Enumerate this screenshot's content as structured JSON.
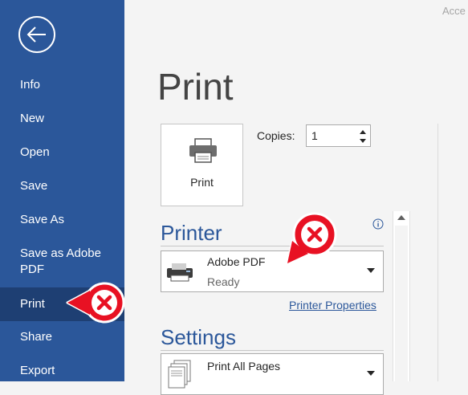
{
  "header": {
    "top_right_text": "Acce"
  },
  "sidebar": {
    "items": [
      {
        "label": "Info"
      },
      {
        "label": "New"
      },
      {
        "label": "Open"
      },
      {
        "label": "Save"
      },
      {
        "label": "Save As"
      },
      {
        "label_line1": "Save as Adobe",
        "label_line2": "PDF"
      },
      {
        "label": "Print",
        "selected": true
      },
      {
        "label": "Share"
      },
      {
        "label": "Export"
      }
    ]
  },
  "main": {
    "title": "Print",
    "print_button_label": "Print",
    "copies": {
      "label": "Copies:",
      "value": "1"
    },
    "printer_section": {
      "title": "Printer",
      "selected_printer": "Adobe PDF",
      "status": "Ready",
      "properties_link": "Printer Properties"
    },
    "settings_section": {
      "title": "Settings",
      "pages_option": "Print All Pages"
    }
  },
  "colors": {
    "sidebar_bg": "#2b579a",
    "sidebar_selected": "#1e3f73",
    "accent": "#2b579a",
    "error_red": "#e81123"
  },
  "icons": [
    "back-arrow-icon",
    "printer-icon",
    "info-icon",
    "pdf-printer-icon",
    "dropdown-arrow-icon",
    "pages-icon",
    "error-x-icon"
  ]
}
